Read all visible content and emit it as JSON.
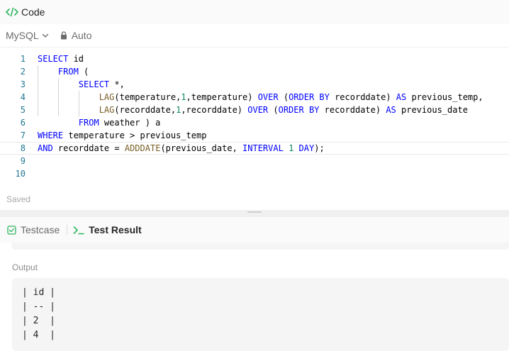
{
  "code_panel": {
    "title": "Code",
    "language": "MySQL",
    "mode": "Auto",
    "status": "Saved",
    "lines": [
      {
        "num": "1",
        "tokens": [
          {
            "t": "SELECT",
            "c": "kw"
          },
          {
            "t": " id",
            "c": ""
          }
        ]
      },
      {
        "num": "2",
        "tokens": [
          {
            "t": "    ",
            "c": ""
          },
          {
            "t": "FROM",
            "c": "kw"
          },
          {
            "t": " (",
            "c": ""
          }
        ]
      },
      {
        "num": "3",
        "tokens": [
          {
            "t": "        ",
            "c": ""
          },
          {
            "t": "SELECT",
            "c": "kw"
          },
          {
            "t": " *,",
            "c": ""
          }
        ]
      },
      {
        "num": "4",
        "tokens": [
          {
            "t": "            ",
            "c": ""
          },
          {
            "t": "LAG",
            "c": "fn"
          },
          {
            "t": "(temperature,",
            "c": ""
          },
          {
            "t": "1",
            "c": "num"
          },
          {
            "t": ",temperature) ",
            "c": ""
          },
          {
            "t": "OVER",
            "c": "kw"
          },
          {
            "t": " (",
            "c": ""
          },
          {
            "t": "ORDER BY",
            "c": "kw"
          },
          {
            "t": " recorddate) ",
            "c": ""
          },
          {
            "t": "AS",
            "c": "kw"
          },
          {
            "t": " previous_temp,",
            "c": ""
          }
        ]
      },
      {
        "num": "5",
        "tokens": [
          {
            "t": "            ",
            "c": ""
          },
          {
            "t": "LAG",
            "c": "fn"
          },
          {
            "t": "(recorddate,",
            "c": ""
          },
          {
            "t": "1",
            "c": "num"
          },
          {
            "t": ",recorddate) ",
            "c": ""
          },
          {
            "t": "OVER",
            "c": "kw"
          },
          {
            "t": " (",
            "c": ""
          },
          {
            "t": "ORDER BY",
            "c": "kw"
          },
          {
            "t": " recorddate) ",
            "c": ""
          },
          {
            "t": "AS",
            "c": "kw"
          },
          {
            "t": " previous_date",
            "c": ""
          }
        ]
      },
      {
        "num": "6",
        "tokens": [
          {
            "t": "        ",
            "c": ""
          },
          {
            "t": "FROM",
            "c": "kw"
          },
          {
            "t": " weather ) a",
            "c": ""
          }
        ]
      },
      {
        "num": "7",
        "tokens": [
          {
            "t": "WHERE",
            "c": "kw"
          },
          {
            "t": " temperature ",
            "c": ""
          },
          {
            "t": ">",
            "c": "op"
          },
          {
            "t": " previous_temp",
            "c": ""
          }
        ]
      },
      {
        "num": "8",
        "tokens": [
          {
            "t": "AND",
            "c": "kw"
          },
          {
            "t": " recorddate ",
            "c": ""
          },
          {
            "t": "=",
            "c": "op"
          },
          {
            "t": " ",
            "c": ""
          },
          {
            "t": "ADDDATE",
            "c": "fn"
          },
          {
            "t": "(previous_date, ",
            "c": ""
          },
          {
            "t": "INTERVAL",
            "c": "kw"
          },
          {
            "t": " ",
            "c": ""
          },
          {
            "t": "1",
            "c": "num"
          },
          {
            "t": " ",
            "c": ""
          },
          {
            "t": "DAY",
            "c": "kw"
          },
          {
            "t": ");",
            "c": ""
          }
        ]
      },
      {
        "num": "9",
        "tokens": []
      },
      {
        "num": "10",
        "tokens": []
      }
    ]
  },
  "test_panel": {
    "tabs": [
      {
        "label": "Testcase",
        "icon": "checkbox-icon",
        "active": false
      },
      {
        "label": "Test Result",
        "icon": "terminal-icon",
        "active": true
      }
    ],
    "output_label": "Output",
    "output_lines": [
      "| id |",
      "| -- |",
      "| 2  |",
      "| 4  |"
    ]
  },
  "colors": {
    "accent_green": "#2db55d",
    "keyword_blue": "#0000ff",
    "function_brown": "#795e26",
    "number_green": "#098658",
    "line_number": "#237893"
  }
}
